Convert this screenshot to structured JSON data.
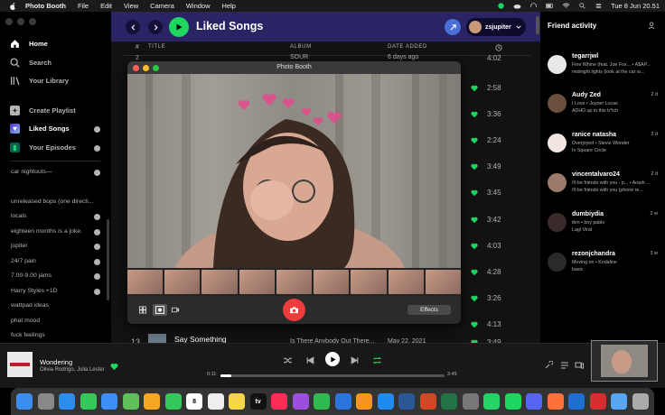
{
  "menubar": {
    "app": "Photo Booth",
    "items": [
      "File",
      "Edit",
      "View",
      "Camera",
      "Window",
      "Help"
    ],
    "clock": "Tue 8 Jun  20.51"
  },
  "sidebar": {
    "nav": [
      {
        "label": "Home",
        "icon": "home-icon"
      },
      {
        "label": "Search",
        "icon": "search-icon"
      },
      {
        "label": "Your Library",
        "icon": "library-icon"
      }
    ],
    "create_playlist": "Create Playlist",
    "liked_songs": "Liked Songs",
    "your_episodes": "Your Episodes",
    "playlists": [
      "car nightouts—",
      "unreleased bops (one directi...",
      "locals",
      "eighteen months is a joke.",
      "jupiter",
      "24/7 pain",
      "7.00-9.00 jams",
      "Harry Styles +1D",
      "wattpad ideas",
      "phat mood",
      "fuck feelings"
    ]
  },
  "header": {
    "title": "Liked Songs",
    "username": "zsjupiter"
  },
  "columns": {
    "num": "#",
    "title": "TITLE",
    "album": "ALBUM",
    "date": "DATE ADDED"
  },
  "tracks_partial": {
    "top_num": "2",
    "top_album": "SOUR",
    "top_date": "6 days ago",
    "top_time": "4:02",
    "times": [
      "2:58",
      "3:36",
      "2:24",
      "3:49",
      "3:45",
      "3:42",
      "4:03",
      "4:28",
      "3:26",
      "4:13"
    ],
    "last": {
      "num": "13",
      "title": "Say Something",
      "album": "Is There Anybody Out There...",
      "date": "May 22, 2021",
      "time": "3:49"
    }
  },
  "friends": {
    "title": "Friend activity",
    "list": [
      {
        "name": "tegarrjwl",
        "time": "",
        "line1": "Fine Whine (feat. Joe Fox... • A$AP...",
        "line2": "midnight lights (look at the car w..."
      },
      {
        "name": "Audy Zed",
        "time": "2 d",
        "line1": "I Love • Joyner Lucas",
        "line2": "ADHD up in this b*tch"
      },
      {
        "name": "ranice natasha",
        "time": "2 d",
        "line1": "Overjoyed • Stevie Wonder",
        "line2": "In Square Circle"
      },
      {
        "name": "vincentalvaro24",
        "time": "2 d",
        "line1": "i'll be friends with you - p... • Arash ...",
        "line2": "i'll be friends with you (phone re..."
      },
      {
        "name": "dumbiydia",
        "time": "2 w",
        "line1": "tkm • boy pablo",
        "line2": "Lagi Viral"
      },
      {
        "name": "rezonjchandra",
        "time": "3 w",
        "line1": "Moving on • Kodaline",
        "line2": "basic"
      }
    ]
  },
  "nowplaying": {
    "title": "Wondering",
    "artist": "Olivia Rodrigo, Julia Lester",
    "elapsed": "0:11",
    "duration": "3:45",
    "progress_fraction": 0.05
  },
  "photobooth": {
    "title": "Photo Booth",
    "effects": "Effects"
  },
  "dock": {
    "calendar_day": "8",
    "tv_label": "tv"
  },
  "colors": {
    "spotify_green": "#1ed760",
    "header_purple": "#2a2465",
    "shutter_red": "#ee3b3b"
  }
}
